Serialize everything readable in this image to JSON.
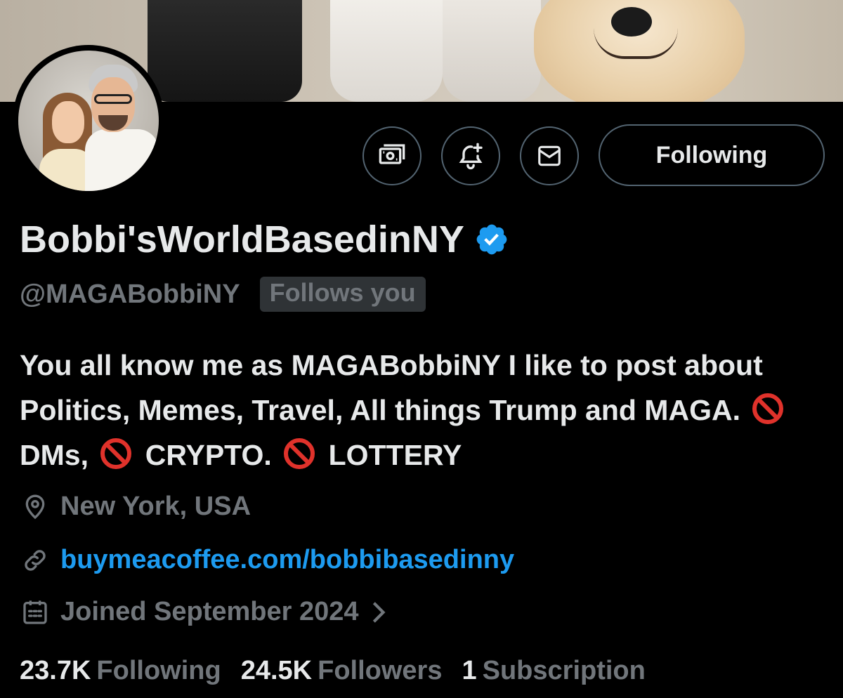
{
  "colors": {
    "background": "#000000",
    "text_primary": "#e7e9ea",
    "text_secondary": "#71767b",
    "link": "#1d9bf0",
    "verified": "#1d9bf0",
    "border": "#536471",
    "badge_bg": "#2f3336",
    "prohibited_red": "#e0322b"
  },
  "header": {
    "actions": {
      "tip_icon": "money-icon",
      "notify_icon": "bell-plus-icon",
      "message_icon": "envelope-icon",
      "following_label": "Following"
    }
  },
  "profile": {
    "display_name": "Bobbi'sWorldBasedinNY",
    "verified_icon": "verified-badge-icon",
    "handle": "@MAGABobbiNY",
    "follows_you": "Follows you",
    "bio": {
      "part1": "You all know me as MAGABobbiNY I like to post about Politics, Memes, Travel, All things Trump and MAGA.",
      "part2": "DMs,",
      "part3": "CRYPTO.",
      "part4": "LOTTERY"
    },
    "location": "New York, USA",
    "link": "buymeacoffee.com/bobbibasedinny",
    "joined": "Joined September 2024"
  },
  "stats": {
    "following_count": "23.7K",
    "following_label": "Following",
    "followers_count": "24.5K",
    "followers_label": "Followers",
    "subscription_count": "1",
    "subscription_label": "Subscription"
  }
}
